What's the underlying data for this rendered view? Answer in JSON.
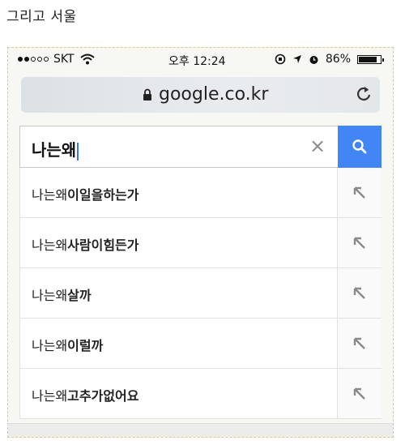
{
  "caption": "그리고 서울",
  "status_bar": {
    "carrier": "SKT",
    "time": "오후 12:24",
    "battery": "86%",
    "battery_level": 0.86
  },
  "browser": {
    "url": "google.co.kr"
  },
  "search": {
    "query": "나는왜"
  },
  "suggestions": [
    {
      "prefix": "나는왜",
      "rest": "이일을하는가"
    },
    {
      "prefix": "나는왜",
      "rest": "사람이힘든가"
    },
    {
      "prefix": "나는왜",
      "rest": "살까"
    },
    {
      "prefix": "나는왜",
      "rest": "이럴까"
    },
    {
      "prefix": "나는왜",
      "rest": "고추가없어요"
    }
  ],
  "colors": {
    "search_button": "#4285f4",
    "cursor": "#3b78e7"
  },
  "icons": [
    "signal-dots-icon",
    "wifi-icon",
    "lock-icon",
    "reload-icon",
    "clear-icon",
    "search-icon",
    "fill-arrow-icon",
    "alarm-icon",
    "location-icon",
    "rotation-lock-icon",
    "battery-icon"
  ]
}
